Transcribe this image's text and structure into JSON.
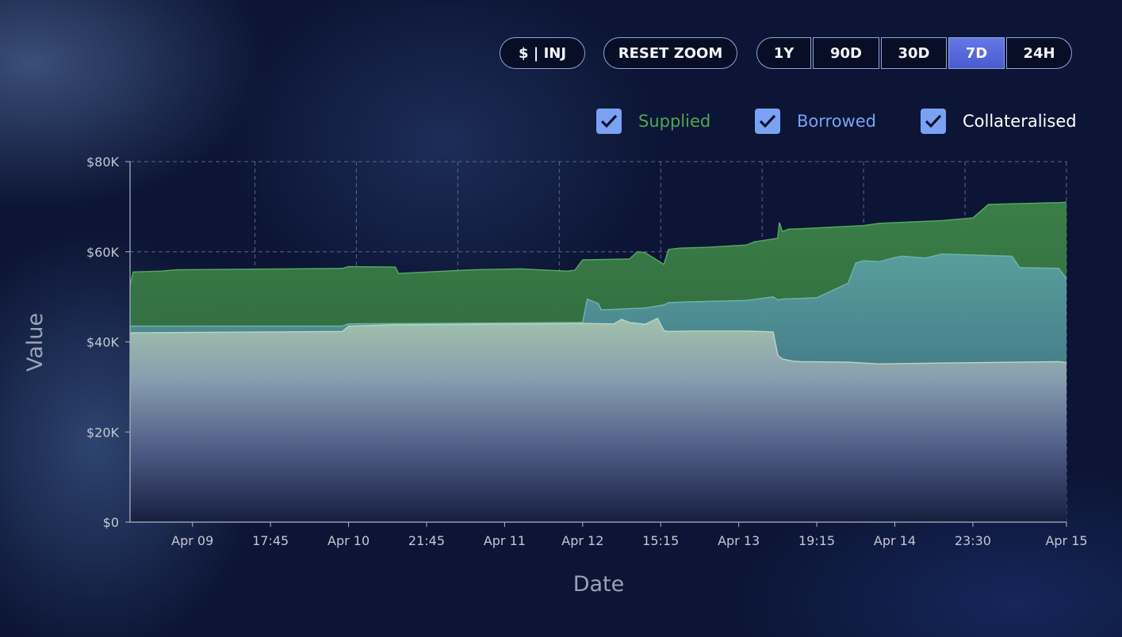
{
  "controls": {
    "currency_toggle": "$ | INJ",
    "reset_zoom": "RESET ZOOM",
    "ranges": [
      "1Y",
      "90D",
      "30D",
      "7D",
      "24H"
    ],
    "active_range": "7D"
  },
  "legend": [
    {
      "label": "Supplied",
      "checked": true,
      "color": "#4fa552"
    },
    {
      "label": "Borrowed",
      "checked": true,
      "color": "#7aa2f2"
    },
    {
      "label": "Collateralised",
      "checked": true,
      "color": "#ffffff"
    }
  ],
  "colors": {
    "supplied_fill": "#3f7a4a",
    "borrowed_fill": "#4a8c92",
    "collateralised_fill": "#a9c3b3",
    "checkbox": "#7aa2f2",
    "active_button": "#5566dd"
  },
  "chart_data": {
    "type": "area",
    "title": "",
    "xlabel": "Date",
    "ylabel": "Value",
    "ylim": [
      0,
      80000
    ],
    "y_ticks": [
      0,
      20000,
      40000,
      60000,
      80000
    ],
    "y_tick_labels": [
      "$0",
      "$20K",
      "$40K",
      "$60K",
      "$80K"
    ],
    "x_ticks": [
      0.8,
      1.45,
      2.1,
      2.75,
      3.4,
      4.05,
      4.7,
      5.35,
      6.0,
      6.65,
      7.3
    ],
    "x_tick_labels": [
      "Apr 09",
      "17:45",
      "Apr 10",
      "21:45",
      "Apr 11",
      "Apr 12",
      "15:15",
      "Apr 13",
      "19:15",
      "Apr 14",
      "23:30",
      "Apr 15"
    ],
    "x_tick_positions": [
      0.4,
      0.9,
      1.4,
      1.9,
      2.4,
      2.9,
      3.4,
      3.9,
      4.4,
      4.9,
      5.4,
      6.0
    ],
    "x_range": [
      0,
      6.0
    ],
    "grid": true,
    "legend_position": "top-right",
    "series": [
      {
        "name": "Supplied",
        "x": [
          0,
          0.02,
          0.2,
          0.3,
          1.36,
          1.4,
          1.7,
          1.72,
          2.2,
          2.5,
          2.8,
          2.85,
          2.9,
          3.2,
          3.25,
          3.3,
          3.42,
          3.45,
          3.52,
          3.7,
          3.95,
          4.0,
          4.15,
          4.16,
          4.18,
          4.22,
          4.3,
          4.7,
          4.8,
          5.2,
          5.3,
          5.4,
          5.5,
          5.95,
          6.0
        ],
        "values": [
          52500,
          55500,
          55700,
          56000,
          56300,
          56700,
          56600,
          55200,
          56000,
          56200,
          55700,
          55900,
          58200,
          58400,
          60000,
          59800,
          57200,
          60500,
          60800,
          61000,
          61500,
          62200,
          63000,
          66500,
          64500,
          65000,
          65100,
          65800,
          66300,
          66900,
          67200,
          67500,
          70500,
          70900,
          71000
        ]
      },
      {
        "name": "Borrowed",
        "x": [
          0,
          0.02,
          1.36,
          1.4,
          2.9,
          2.93,
          3.0,
          3.02,
          3.3,
          3.42,
          3.45,
          3.6,
          3.95,
          4.12,
          4.15,
          4.18,
          4.4,
          4.6,
          4.65,
          4.7,
          4.8,
          4.9,
          4.95,
          5.1,
          5.2,
          5.3,
          5.65,
          5.7,
          5.95,
          6.0
        ],
        "values": [
          43500,
          43500,
          43500,
          44000,
          44300,
          49500,
          48500,
          47100,
          47500,
          48200,
          48700,
          48900,
          49200,
          50000,
          49300,
          49500,
          49800,
          53000,
          57500,
          58000,
          57800,
          58700,
          59000,
          58600,
          59500,
          59400,
          59000,
          56500,
          56300,
          54000
        ]
      },
      {
        "name": "Collateralised",
        "x": [
          0,
          0.02,
          1.36,
          1.4,
          1.7,
          2.2,
          2.6,
          2.9,
          3.1,
          3.15,
          3.2,
          3.3,
          3.38,
          3.42,
          3.45,
          3.6,
          3.95,
          4.12,
          4.15,
          4.18,
          4.25,
          4.3,
          4.6,
          4.8,
          5.0,
          5.4,
          5.95,
          6.0
        ],
        "values": [
          42000,
          42000,
          42300,
          43500,
          43800,
          43900,
          44000,
          44100,
          44000,
          45000,
          44300,
          43900,
          45200,
          42500,
          42300,
          42400,
          42400,
          42200,
          37000,
          36200,
          35700,
          35600,
          35500,
          35100,
          35200,
          35400,
          35600,
          35400
        ]
      }
    ]
  }
}
